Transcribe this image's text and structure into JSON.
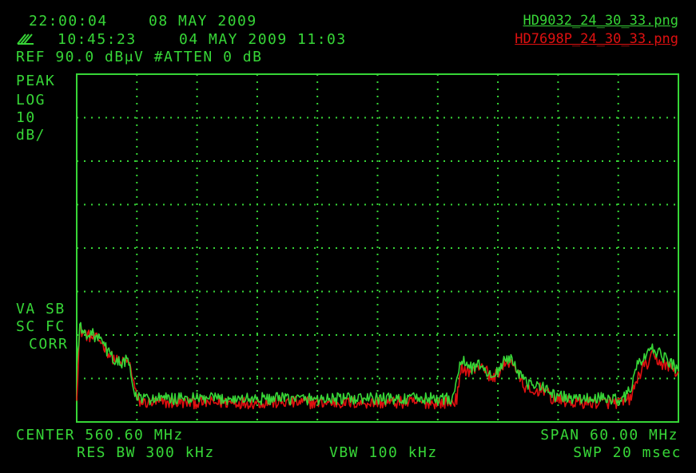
{
  "header": {
    "clock": "22:00:04",
    "date": "08 MAY 2009",
    "stored_time": "10:45:23",
    "stored_date": "04 MAY 2009 11:03",
    "ref_line": "REF 90.0 dBμV #ATTEN 0 dB"
  },
  "files": {
    "green": "HD9032_24_30_33.png",
    "red": "HD7698P_24_30_33.png"
  },
  "left_labels": {
    "detector": "PEAK",
    "scale": "LOG",
    "div_value": "10",
    "div_unit": "dB/",
    "va_sb": "VA SB",
    "sc_fc": "SC FC",
    "corr": "CORR"
  },
  "footer": {
    "center": "CENTER 560.60 MHz",
    "span": "SPAN 60.00 MHz",
    "res_bw": "RES BW 300 kHz",
    "vbw": "VBW 100 kHz",
    "swp": "SWP 20 msec"
  },
  "colors": {
    "green": "#37d637",
    "red": "#e01010",
    "background": "#000000"
  },
  "icons": {
    "marker": "trace-marker-icon"
  },
  "chart_data": {
    "type": "line",
    "xlim": [
      530.6,
      590.6
    ],
    "ylim": [
      0,
      90
    ],
    "grid": true,
    "x_divisions": 10,
    "y_divisions": 8,
    "series": [
      {
        "name": "HD9032_24_30_33.png",
        "color": "#37d637",
        "x": [
          530.6,
          530.9,
          531.2,
          532.0,
          533.0,
          534.0,
          535.0,
          535.6,
          536.0,
          536.3,
          537.0,
          538.0,
          540.0,
          545.0,
          550.0,
          555.0,
          560.0,
          566.0,
          568.0,
          568.3,
          569.0,
          570.0,
          571.0,
          572.0,
          573.0,
          574.0,
          575.0,
          576.0,
          577.0,
          578.0,
          580.0,
          583.0,
          585.0,
          585.8,
          586.5,
          587.0,
          587.5,
          588.0,
          589.0,
          590.0,
          590.6
        ],
        "y": [
          14,
          25,
          23,
          23,
          21,
          17,
          15,
          16,
          13,
          7,
          6,
          6,
          6,
          6,
          6,
          6,
          6,
          6,
          6,
          9,
          16,
          14,
          15,
          11,
          15,
          17,
          11,
          9,
          10,
          7,
          6,
          6,
          6,
          8,
          15,
          16,
          17,
          19,
          17,
          15,
          13
        ]
      },
      {
        "name": "HD7698P_24_30_33.png",
        "color": "#e01010",
        "x": [
          530.6,
          530.9,
          531.2,
          532.0,
          533.0,
          534.0,
          535.0,
          535.6,
          536.0,
          536.3,
          536.6,
          537.0,
          538.0,
          540.0,
          545.0,
          550.0,
          555.0,
          560.0,
          566.0,
          568.0,
          568.5,
          569.0,
          570.0,
          571.0,
          572.0,
          573.0,
          574.0,
          575.0,
          576.0,
          577.0,
          578.0,
          580.0,
          583.0,
          585.0,
          585.8,
          586.5,
          587.0,
          587.5,
          588.0,
          589.0,
          590.0,
          590.6
        ],
        "y": [
          7,
          24,
          23,
          22,
          21,
          17,
          15,
          16,
          14,
          10,
          6,
          5,
          5,
          5,
          5,
          5,
          5,
          5,
          5,
          5,
          6,
          14,
          13,
          15,
          11,
          14,
          16,
          10,
          7,
          9,
          6,
          5,
          5,
          5,
          6,
          11,
          14,
          15,
          17,
          15,
          14,
          12
        ]
      }
    ]
  }
}
